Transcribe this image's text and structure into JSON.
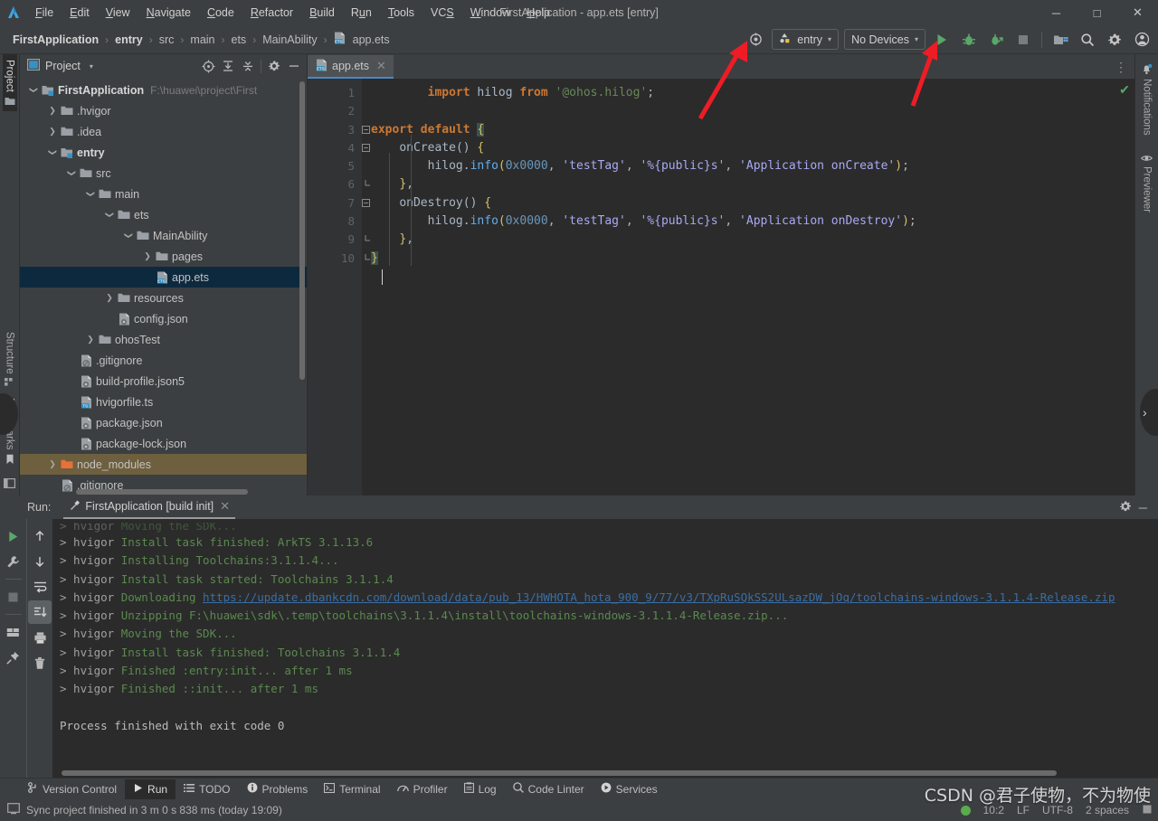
{
  "window": {
    "title": "FirstApplication - app.ets [entry]",
    "minimize": "─",
    "maximize": "□",
    "close": "✕"
  },
  "menubar": {
    "items": [
      {
        "label": "File",
        "mnemonic": "F"
      },
      {
        "label": "Edit",
        "mnemonic": "E"
      },
      {
        "label": "View",
        "mnemonic": "V"
      },
      {
        "label": "Navigate",
        "mnemonic": "N"
      },
      {
        "label": "Code",
        "mnemonic": "C"
      },
      {
        "label": "Refactor",
        "mnemonic": "R"
      },
      {
        "label": "Build",
        "mnemonic": "B"
      },
      {
        "label": "Run",
        "mnemonic": "u"
      },
      {
        "label": "Tools",
        "mnemonic": "T"
      },
      {
        "label": "VCS",
        "mnemonic": "S"
      },
      {
        "label": "Window",
        "mnemonic": "W"
      },
      {
        "label": "Help",
        "mnemonic": "H"
      }
    ]
  },
  "breadcrumb": {
    "separator": "›",
    "items": [
      "FirstApplication",
      "entry",
      "src",
      "main",
      "ets",
      "MainAbility",
      "app.ets"
    ]
  },
  "toolbar": {
    "target_selector": "entry",
    "device_selector": "No Devices",
    "caret": "▾",
    "icons": [
      {
        "name": "sync-icon",
        "glyph": "☉"
      },
      {
        "name": "run-icon",
        "glyph": "▶"
      },
      {
        "name": "debug-icon",
        "glyph": "bug"
      },
      {
        "name": "run-coverage-icon",
        "glyph": "bug-arrow"
      },
      {
        "name": "stop-icon",
        "glyph": "■"
      },
      {
        "name": "project-structure-icon",
        "glyph": "folders"
      },
      {
        "name": "search-everywhere-icon",
        "glyph": "⌕"
      },
      {
        "name": "settings-icon",
        "glyph": "gear"
      },
      {
        "name": "account-icon",
        "glyph": "person"
      }
    ]
  },
  "left_rail": {
    "top": [
      {
        "label": "Project",
        "active": true
      }
    ],
    "bottom": [
      {
        "label": "Structure"
      },
      {
        "label": "Bookmarks"
      }
    ]
  },
  "right_rail": {
    "items": [
      {
        "label": "Notifications"
      },
      {
        "label": "Previewer"
      }
    ]
  },
  "project_panel": {
    "title": "Project",
    "header_icons": [
      "select-opened-file-icon",
      "expand-all-icon",
      "collapse-all-icon",
      "settings-icon",
      "hide-icon"
    ],
    "tree": [
      {
        "depth": 0,
        "arrow": "down",
        "icon": "module-root",
        "label": "FirstApplication",
        "bold": true,
        "hint": "F:\\huawei\\project\\First"
      },
      {
        "depth": 1,
        "arrow": "right",
        "icon": "folder",
        "label": ".hvigor"
      },
      {
        "depth": 1,
        "arrow": "right",
        "icon": "folder",
        "label": ".idea"
      },
      {
        "depth": 1,
        "arrow": "down",
        "icon": "module",
        "label": "entry",
        "bold": true
      },
      {
        "depth": 2,
        "arrow": "down",
        "icon": "folder",
        "label": "src"
      },
      {
        "depth": 3,
        "arrow": "down",
        "icon": "folder",
        "label": "main"
      },
      {
        "depth": 4,
        "arrow": "down",
        "icon": "folder",
        "label": "ets"
      },
      {
        "depth": 5,
        "arrow": "down",
        "icon": "folder",
        "label": "MainAbility"
      },
      {
        "depth": 6,
        "arrow": "right",
        "icon": "folder",
        "label": "pages"
      },
      {
        "depth": 6,
        "arrow": "none",
        "icon": "ets-file",
        "label": "app.ets",
        "selected": true
      },
      {
        "depth": 4,
        "arrow": "right",
        "icon": "folder",
        "label": "resources"
      },
      {
        "depth": 4,
        "arrow": "none",
        "icon": "json-file",
        "label": "config.json"
      },
      {
        "depth": 3,
        "arrow": "right",
        "icon": "folder",
        "label": "ohosTest"
      },
      {
        "depth": 2,
        "arrow": "none",
        "icon": "gitignore-file",
        "label": ".gitignore"
      },
      {
        "depth": 2,
        "arrow": "none",
        "icon": "json-file",
        "label": "build-profile.json5"
      },
      {
        "depth": 2,
        "arrow": "none",
        "icon": "ts-file",
        "label": "hvigorfile.ts"
      },
      {
        "depth": 2,
        "arrow": "none",
        "icon": "json-file",
        "label": "package.json"
      },
      {
        "depth": 2,
        "arrow": "none",
        "icon": "json-file",
        "label": "package-lock.json"
      },
      {
        "depth": 1,
        "arrow": "right",
        "icon": "folder-orange",
        "label": "node_modules",
        "highlight": true
      },
      {
        "depth": 1,
        "arrow": "none",
        "icon": "gitignore-file",
        "label": ".gitignore"
      }
    ]
  },
  "editor": {
    "tab": {
      "label": "app.ets",
      "close": "✕",
      "icon": "ets-file-icon"
    },
    "more_icon": "⋮",
    "inspection_ok": "✔",
    "lines": [
      {
        "n": 1,
        "fold": "",
        "tokens": [
          {
            "t": "import ",
            "c": "k-kw"
          },
          {
            "t": "hilog ",
            "c": "k-id"
          },
          {
            "t": "from ",
            "c": "k-kw"
          },
          {
            "t": "'@ohos.hilog'",
            "c": "k-str2"
          },
          {
            "t": ";",
            "c": "k-pun"
          }
        ],
        "indent": 4
      },
      {
        "n": 2,
        "fold": "",
        "tokens": [],
        "indent": 0
      },
      {
        "n": 3,
        "fold": "-",
        "tokens": [
          {
            "t": "export default ",
            "c": "k-kw"
          },
          {
            "t": "{",
            "c": "k-hl"
          }
        ],
        "indent": 0
      },
      {
        "n": 4,
        "fold": "-",
        "tokens": [
          {
            "t": "onCreate",
            "c": "k-id"
          },
          {
            "t": "() ",
            "c": "k-pun"
          },
          {
            "t": "{",
            "c": "k-brace"
          }
        ],
        "indent": 2
      },
      {
        "n": 5,
        "fold": "",
        "tokens": [
          {
            "t": "hilog",
            "c": "k-id"
          },
          {
            "t": ".",
            "c": "k-pun"
          },
          {
            "t": "info",
            "c": "k-fn"
          },
          {
            "t": "(",
            "c": "k-brace"
          },
          {
            "t": "0x0000",
            "c": "k-num"
          },
          {
            "t": ", ",
            "c": "k-pun"
          },
          {
            "t": "'testTag'",
            "c": "k-str"
          },
          {
            "t": ", ",
            "c": "k-pun"
          },
          {
            "t": "'%{public}s'",
            "c": "k-str"
          },
          {
            "t": ", ",
            "c": "k-pun"
          },
          {
            "t": "'Application onCreate'",
            "c": "k-str"
          },
          {
            "t": ")",
            "c": "k-brace"
          },
          {
            "t": ";",
            "c": "k-pun"
          }
        ],
        "indent": 4
      },
      {
        "n": 6,
        "fold": "u",
        "tokens": [
          {
            "t": "}",
            "c": "k-brace"
          },
          {
            "t": ",",
            "c": "k-pun"
          }
        ],
        "indent": 2
      },
      {
        "n": 7,
        "fold": "-",
        "tokens": [
          {
            "t": "onDestroy",
            "c": "k-id"
          },
          {
            "t": "() ",
            "c": "k-pun"
          },
          {
            "t": "{",
            "c": "k-brace"
          }
        ],
        "indent": 2
      },
      {
        "n": 8,
        "fold": "",
        "tokens": [
          {
            "t": "hilog",
            "c": "k-id"
          },
          {
            "t": ".",
            "c": "k-pun"
          },
          {
            "t": "info",
            "c": "k-fn"
          },
          {
            "t": "(",
            "c": "k-brace"
          },
          {
            "t": "0x0000",
            "c": "k-num"
          },
          {
            "t": ", ",
            "c": "k-pun"
          },
          {
            "t": "'testTag'",
            "c": "k-str"
          },
          {
            "t": ", ",
            "c": "k-pun"
          },
          {
            "t": "'%{public}s'",
            "c": "k-str"
          },
          {
            "t": ", ",
            "c": "k-pun"
          },
          {
            "t": "'Application onDestroy'",
            "c": "k-str"
          },
          {
            "t": ")",
            "c": "k-brace"
          },
          {
            "t": ";",
            "c": "k-pun"
          }
        ],
        "indent": 4
      },
      {
        "n": 9,
        "fold": "u",
        "tokens": [
          {
            "t": "}",
            "c": "k-brace"
          },
          {
            "t": ",",
            "c": "k-pun"
          }
        ],
        "indent": 2
      },
      {
        "n": 10,
        "fold": "u",
        "tokens": [
          {
            "t": "}",
            "c": "k-hl"
          }
        ],
        "indent": 0
      }
    ]
  },
  "run_panel": {
    "label": "Run:",
    "tab": "FirstApplication [build init]",
    "tab_close": "✕",
    "settings_icon": "gear-icon",
    "hide_icon": "─",
    "tools": [
      {
        "name": "rerun-button",
        "glyph": "▶"
      },
      {
        "name": "edit-configurations-button",
        "glyph": "wrench"
      },
      {
        "name": "stop-button",
        "glyph": "■"
      },
      {
        "name": "layout-button",
        "glyph": "layout"
      },
      {
        "name": "pin-tab-button",
        "glyph": "pin"
      },
      {
        "name": "up-button",
        "glyph": "↑"
      },
      {
        "name": "down-button",
        "glyph": "↓"
      },
      {
        "name": "soft-wrap-button",
        "glyph": "wrap"
      },
      {
        "name": "scroll-to-end-button",
        "glyph": "scroll-end",
        "active": true
      },
      {
        "name": "print-button",
        "glyph": "printer"
      },
      {
        "name": "clear-all-button",
        "glyph": "trash"
      }
    ],
    "console": [
      {
        "parts": [
          {
            "t": "> hvigor ",
            "c": "c-gray"
          },
          {
            "t": "Moving the SDK...",
            "c": "c-green"
          }
        ],
        "clipped": true
      },
      {
        "parts": [
          {
            "t": "> hvigor ",
            "c": "c-gray"
          },
          {
            "t": "Install task finished: ArkTS 3.1.13.6",
            "c": "c-green"
          }
        ]
      },
      {
        "parts": [
          {
            "t": "> hvigor ",
            "c": "c-gray"
          },
          {
            "t": "Installing Toolchains:3.1.1.4...",
            "c": "c-green"
          }
        ]
      },
      {
        "parts": [
          {
            "t": "> hvigor ",
            "c": "c-gray"
          },
          {
            "t": "Install task started: Toolchains 3.1.1.4",
            "c": "c-green"
          }
        ]
      },
      {
        "parts": [
          {
            "t": "> hvigor ",
            "c": "c-gray"
          },
          {
            "t": "Downloading ",
            "c": "c-green"
          },
          {
            "t": "https://update.dbankcdn.com/download/data/pub_13/HWHOTA_hota_900_9/77/v3/TXpRuSQkSS2ULsazDW_jOq/toolchains-windows-3.1.1.4-Release.zip",
            "c": "c-link"
          }
        ]
      },
      {
        "parts": [
          {
            "t": "> hvigor ",
            "c": "c-gray"
          },
          {
            "t": "Unzipping F:\\huawei\\sdk\\.temp\\toolchains\\3.1.1.4\\install\\toolchains-windows-3.1.1.4-Release.zip...",
            "c": "c-green"
          }
        ]
      },
      {
        "parts": [
          {
            "t": "> hvigor ",
            "c": "c-gray"
          },
          {
            "t": "Moving the SDK...",
            "c": "c-green"
          }
        ]
      },
      {
        "parts": [
          {
            "t": "> hvigor ",
            "c": "c-gray"
          },
          {
            "t": "Install task finished: Toolchains 3.1.1.4",
            "c": "c-green"
          }
        ]
      },
      {
        "parts": [
          {
            "t": "> hvigor ",
            "c": "c-gray"
          },
          {
            "t": "Finished :entry:init... after 1 ms",
            "c": "c-green"
          }
        ]
      },
      {
        "parts": [
          {
            "t": "> hvigor ",
            "c": "c-gray"
          },
          {
            "t": "Finished ::init... after 1 ms",
            "c": "c-green"
          }
        ]
      },
      {
        "parts": []
      },
      {
        "parts": [
          {
            "t": "Process finished with exit code 0",
            "c": "c-white"
          }
        ]
      }
    ]
  },
  "toolwindow_bar": {
    "items": [
      {
        "label": "Version Control",
        "icon": "branch-icon"
      },
      {
        "label": "Run",
        "icon": "play-icon",
        "active": true
      },
      {
        "label": "TODO",
        "icon": "list-icon"
      },
      {
        "label": "Problems",
        "icon": "info-icon"
      },
      {
        "label": "Terminal",
        "icon": "terminal-icon"
      },
      {
        "label": "Profiler",
        "icon": "gauge-icon"
      },
      {
        "label": "Log",
        "icon": "clipboard-icon"
      },
      {
        "label": "Code Linter",
        "icon": "magnifier-icon"
      },
      {
        "label": "Services",
        "icon": "play-circle-icon"
      }
    ]
  },
  "status_bar": {
    "message": "Sync project finished in 3 m 0 s 838 ms (today 19:09)",
    "icon": "event-log-icon",
    "caret_position": "10:2",
    "line_separator": "LF",
    "encoding": "UTF-8",
    "indent": "2 spaces",
    "lock_icon": "■"
  },
  "watermark": "CSDN @君子使物，不为物使",
  "colors": {
    "accent_blue": "#4a88c7",
    "selection": "#0d293e",
    "run_green": "#5aab4f",
    "annotation_red": "#ee1c25",
    "node_modules_highlight": "#6e5f3e"
  }
}
